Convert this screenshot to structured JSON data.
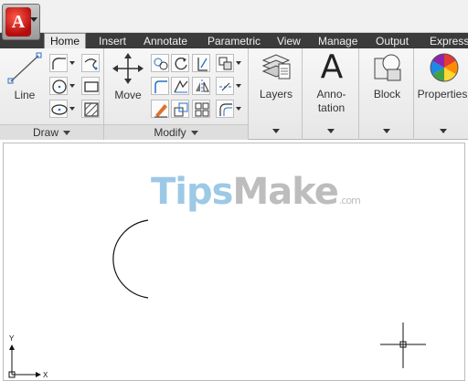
{
  "app": {
    "logo_letter": "A"
  },
  "tabs": [
    {
      "label": "Home",
      "active": true
    },
    {
      "label": "Insert",
      "active": false
    },
    {
      "label": "Annotate",
      "active": false
    },
    {
      "label": "Parametric",
      "active": false
    },
    {
      "label": "View",
      "active": false
    },
    {
      "label": "Manage",
      "active": false
    },
    {
      "label": "Output",
      "active": false
    },
    {
      "label": "Express",
      "active": false
    }
  ],
  "ribbon": {
    "draw": {
      "title": "Draw",
      "line_label": "Line"
    },
    "modify": {
      "title": "Modify",
      "move_label": "Move"
    },
    "layers": {
      "label": "Layers"
    },
    "annotation": {
      "label_line1": "Anno-",
      "label_line2": "tation"
    },
    "block": {
      "label": "Block"
    },
    "properties": {
      "label": "Properties"
    }
  },
  "canvas": {
    "watermark_part1": "Tips",
    "watermark_part2": "Make",
    "watermark_domain": ".com",
    "ucs_x_label": "X",
    "ucs_y_label": "Y"
  },
  "colors": {
    "tabbar_bg": "#3b3b3b",
    "app_logo_red": "#c0141a",
    "watermark_blue": "#9cc9e6"
  }
}
